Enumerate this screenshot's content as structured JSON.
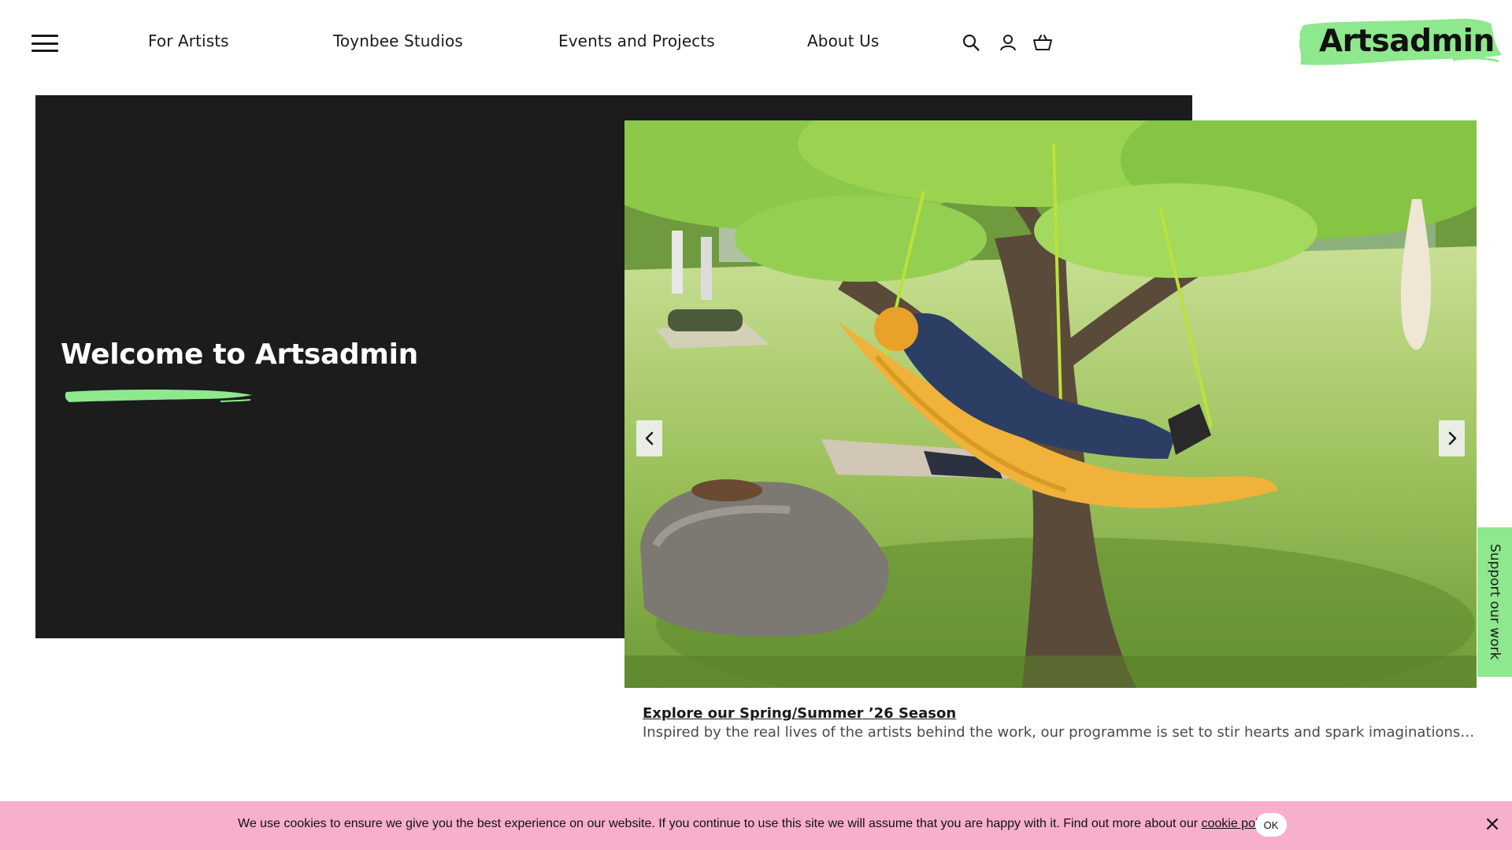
{
  "header": {
    "menu_icon": "hamburger-menu-icon",
    "nav": [
      {
        "label": "For Artists"
      },
      {
        "label": "Toynbee Studios"
      },
      {
        "label": "Events and Projects"
      },
      {
        "label": "About Us"
      }
    ],
    "icons": [
      "search-icon",
      "account-icon",
      "basket-icon"
    ],
    "logo_text": "Artsadmin"
  },
  "hero": {
    "title": "Welcome to Artsadmin",
    "slide_link": "Explore our Spring/Summer ’26 Season",
    "slide_description": "Inspired by the real lives of the artists behind the work, our programme is set to stir hearts and spark imaginations…",
    "prev_icon": "chevron-left-icon",
    "next_icon": "chevron-right-icon"
  },
  "support_tab": {
    "label": "Support our work"
  },
  "cookie": {
    "text": "We use cookies to ensure we give you the best experience on our website. If you continue to use this site we will assume that you are happy with it. Find out more about our ",
    "link": "cookie policy",
    "suffix": ".",
    "ok": "OK",
    "close": "×"
  },
  "colors": {
    "accent_green": "#8ee88e",
    "dark_panel": "#1c1c1c",
    "cookie_pink": "#f7afcb"
  }
}
